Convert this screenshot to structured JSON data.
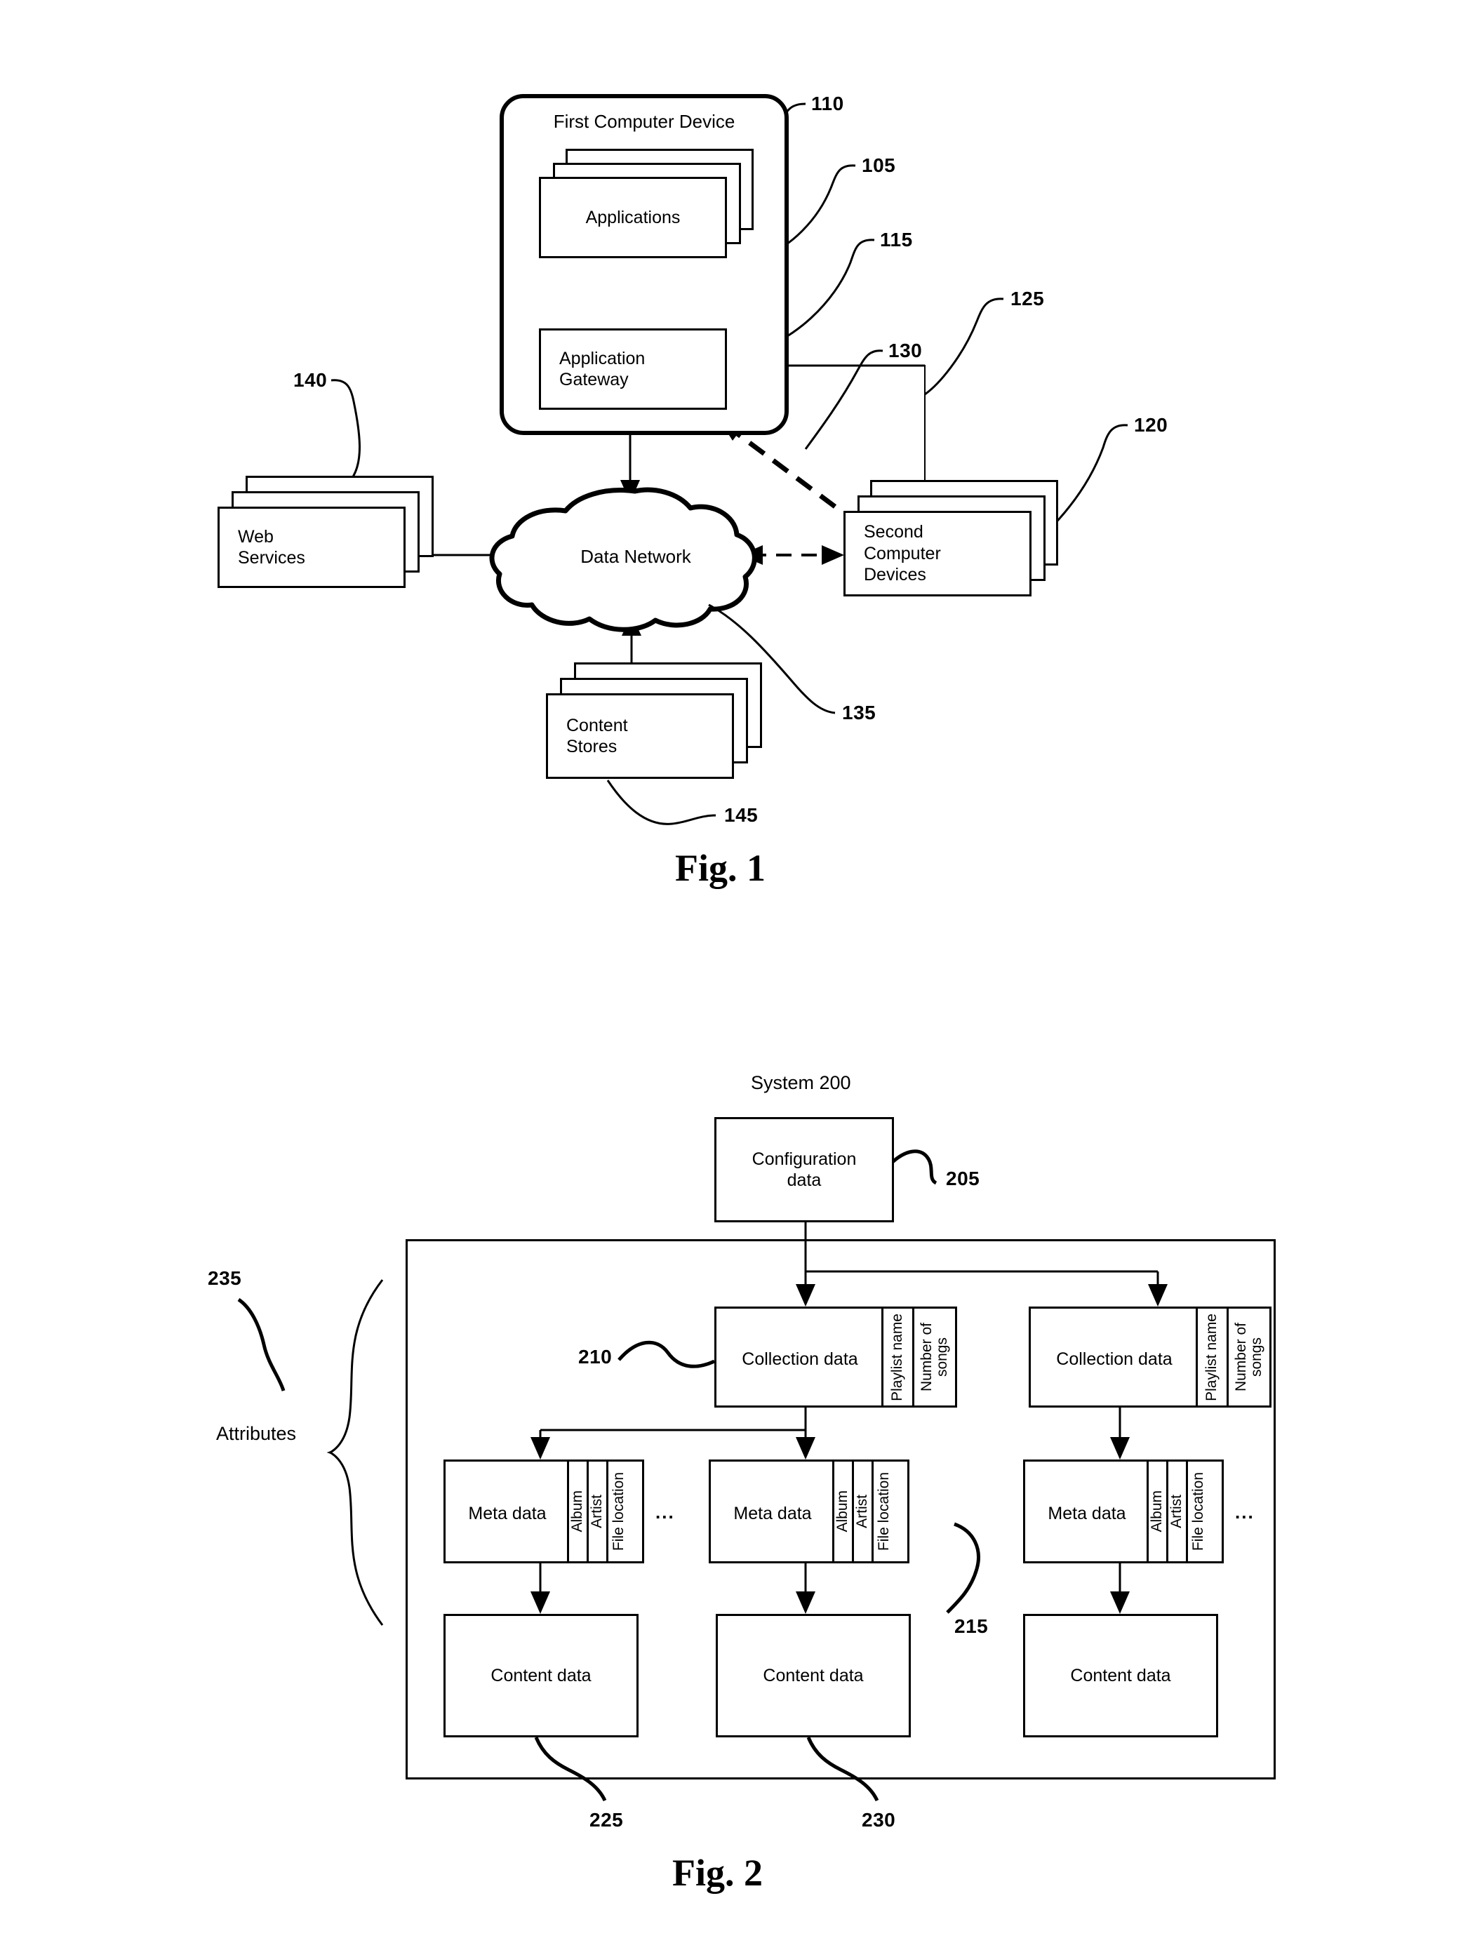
{
  "figures": [
    {
      "caption": "Fig. 1",
      "title": "First Computer Device",
      "nodes": {
        "applications": "Applications",
        "application_gateway": "Application\nGateway",
        "web_services": "Web\nServices",
        "data_network": "Data Network",
        "second_computer_devices": "Second\nComputer\nDevices",
        "content_stores": "Content\nStores"
      },
      "reference_numerals": {
        "first_computer_device": "110",
        "applications": "105",
        "application_gateway": "115",
        "second_computer_devices_link": "130",
        "second_computer_devices_feed": "125",
        "second_computer_devices": "120",
        "web_services": "140",
        "data_network": "135",
        "content_stores": "145"
      }
    },
    {
      "caption": "Fig. 2",
      "system_label": "System 200",
      "nodes": {
        "configuration_data": "Configuration\ndata",
        "collection_data": "Collection data",
        "meta_data": "Meta data",
        "content_data": "Content data"
      },
      "attributes_label": "Attributes",
      "collection_attributes": [
        "Playlist name",
        "Number of\nsongs"
      ],
      "meta_attributes": [
        "Album",
        "Artist",
        "File location"
      ],
      "ellipsis": "...",
      "reference_numerals": {
        "configuration_data": "205",
        "collection_data": "210",
        "meta_data": "215",
        "content_data_left": "225",
        "content_data_middle": "230",
        "attributes": "235"
      }
    }
  ],
  "colors": {
    "ink": "#000000",
    "paper": "#ffffff"
  }
}
